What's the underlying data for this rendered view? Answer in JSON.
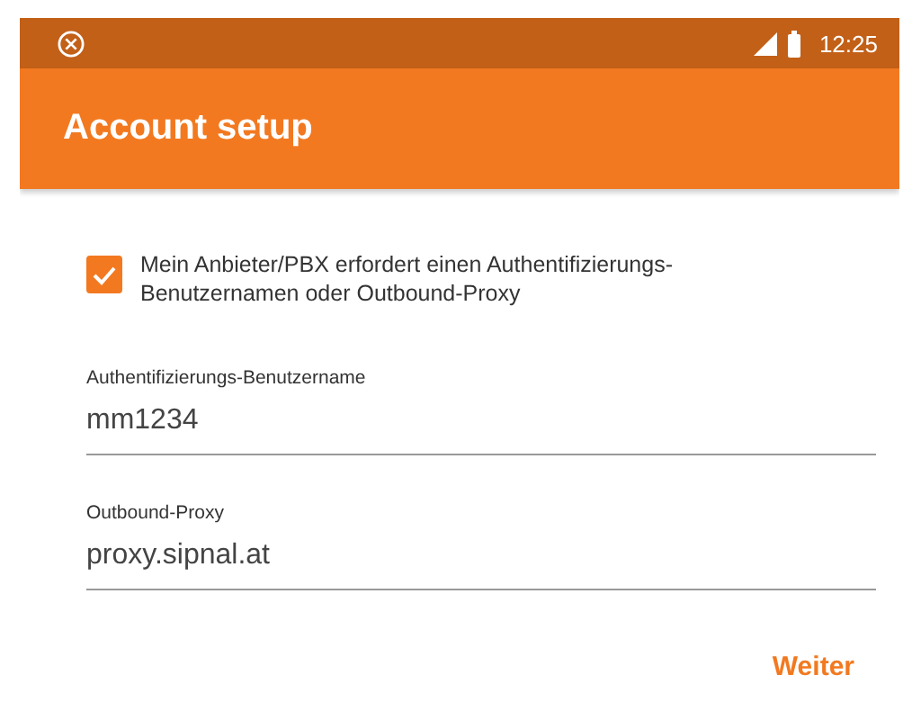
{
  "status_bar": {
    "time": "12:25"
  },
  "app_bar": {
    "title": "Account setup"
  },
  "checkbox": {
    "label": "Mein Anbieter/PBX erfordert einen Authentifizierungs-Benutzernamen oder Outbound-Proxy",
    "checked": true
  },
  "fields": [
    {
      "label": "Authentifizierungs-Benutzername",
      "value": "mm1234"
    },
    {
      "label": "Outbound-Proxy",
      "value": "proxy.sipnal.at"
    }
  ],
  "next_button": "Weiter"
}
